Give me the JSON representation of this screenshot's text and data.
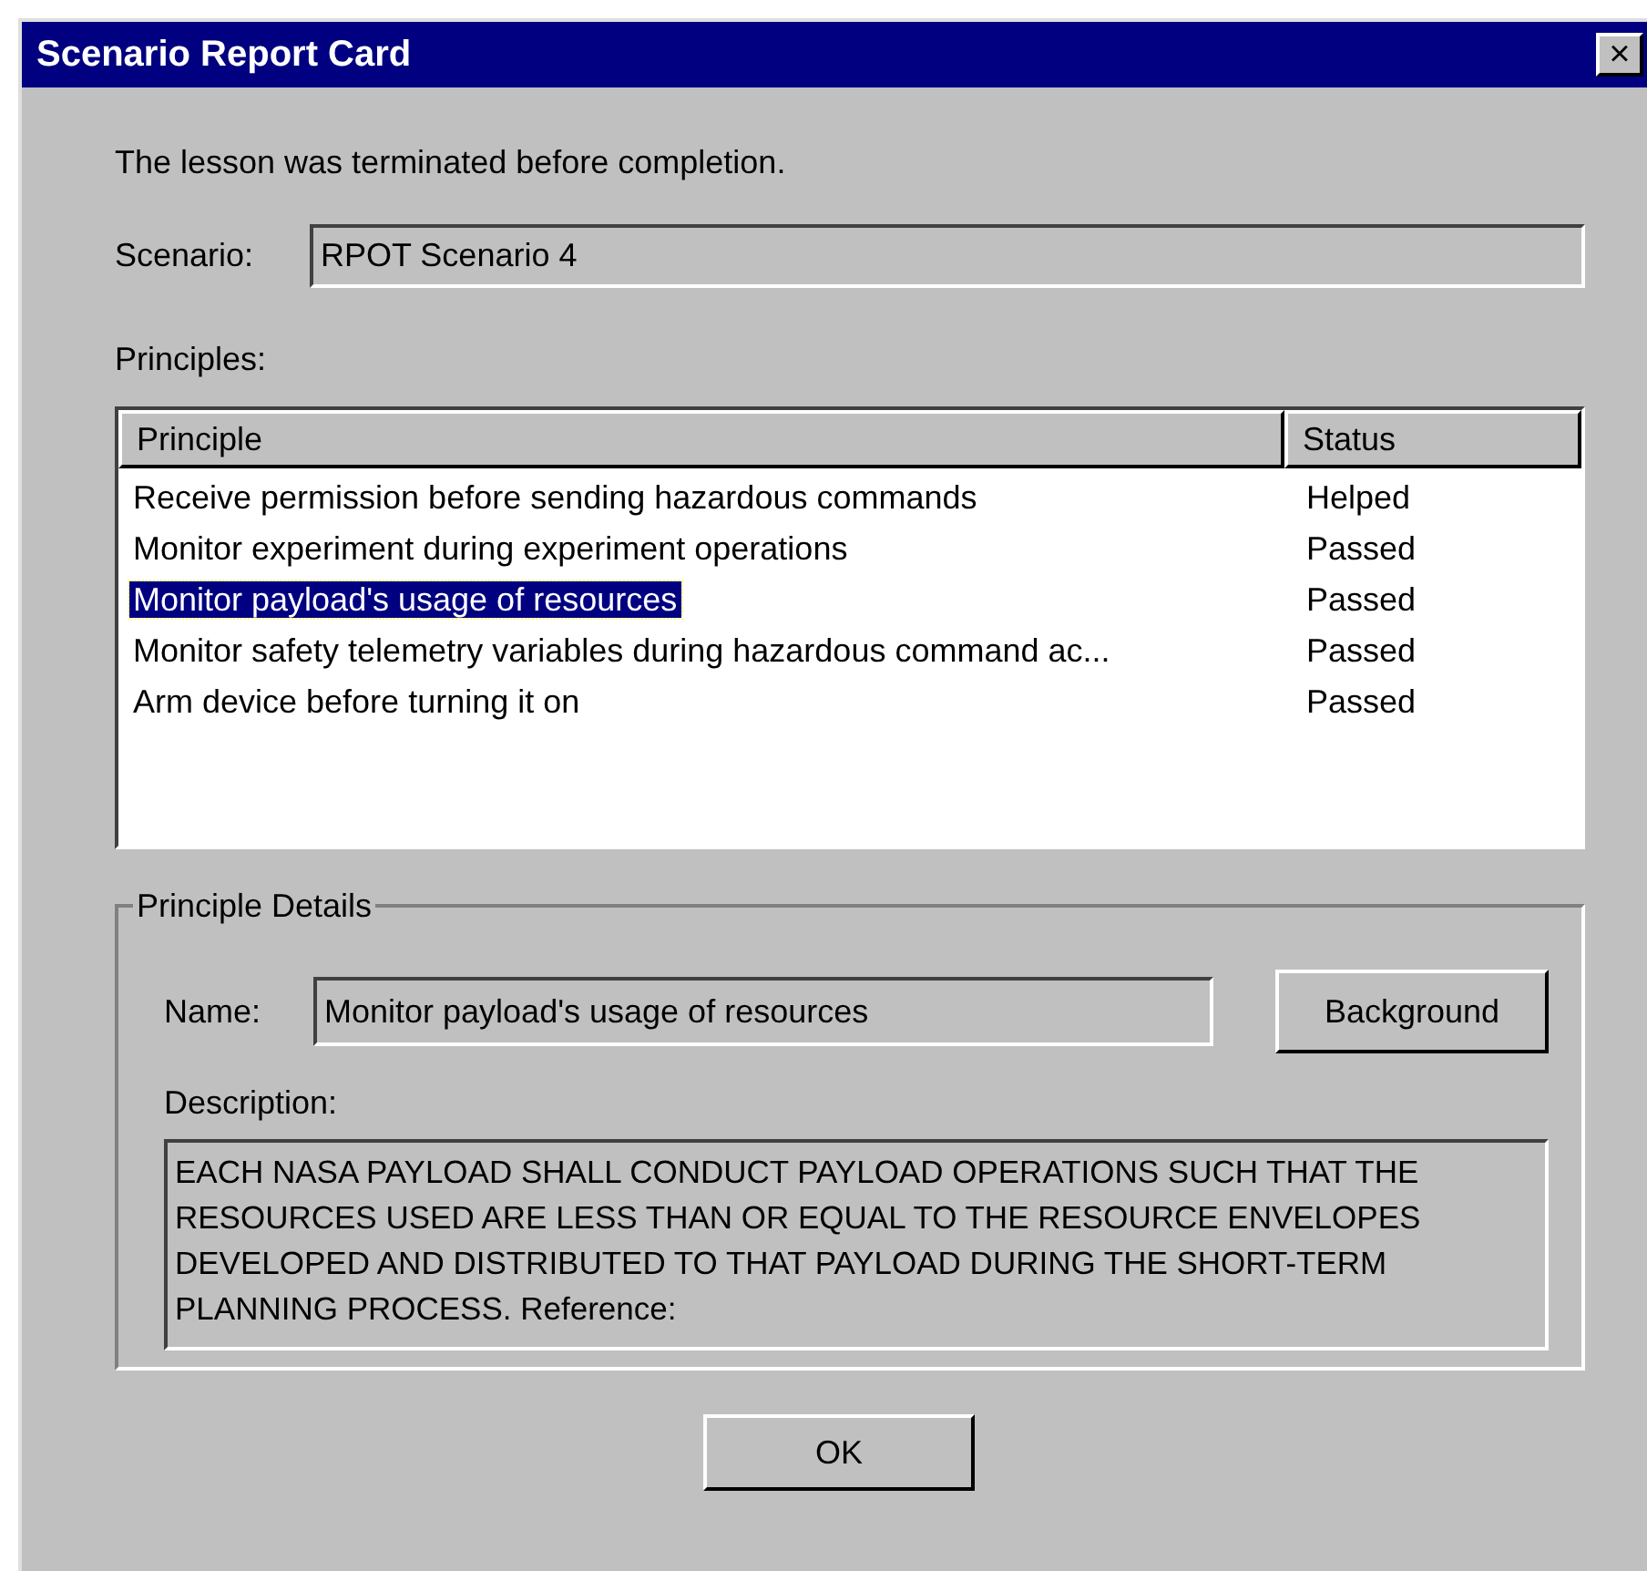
{
  "window": {
    "title": "Scenario Report Card",
    "close": "×"
  },
  "message": "The lesson was terminated before completion.",
  "scenario": {
    "label": "Scenario:",
    "value": "RPOT Scenario 4"
  },
  "principles_label": "Principles:",
  "table": {
    "columns": [
      "Principle",
      "Status"
    ],
    "rows": [
      {
        "principle": "Receive permission before sending hazardous commands",
        "status": "Helped",
        "selected": false
      },
      {
        "principle": "Monitor experiment during experiment operations",
        "status": "Passed",
        "selected": false
      },
      {
        "principle": "Monitor payload's usage of resources",
        "status": "Passed",
        "selected": true
      },
      {
        "principle": "Monitor safety telemetry variables during hazardous command ac...",
        "status": "Passed",
        "selected": false
      },
      {
        "principle": "Arm device before turning it on",
        "status": "Passed",
        "selected": false
      }
    ]
  },
  "details": {
    "title": "Principle Details",
    "name_label": "Name:",
    "name_value": "Monitor payload's usage of resources",
    "background_button": "Background",
    "description_label": "Description:",
    "description": "EACH NASA PAYLOAD SHALL CONDUCT PAYLOAD OPERATIONS SUCH THAT THE RESOURCES USED ARE LESS THAN OR EQUAL TO THE RESOURCE ENVELOPES DEVELOPED AND DISTRIBUTED TO THAT PAYLOAD DURING THE SHORT-TERM PLANNING PROCESS. Reference:"
  },
  "ok_button": "OK"
}
